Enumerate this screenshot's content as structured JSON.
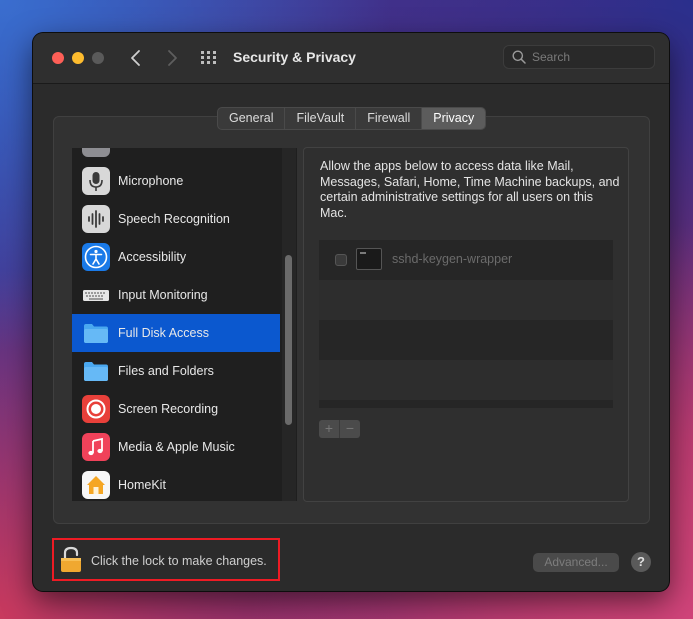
{
  "window": {
    "title": "Security & Privacy",
    "search_placeholder": "Search"
  },
  "tabs": [
    {
      "label": "General",
      "active": false
    },
    {
      "label": "FileVault",
      "active": false
    },
    {
      "label": "Firewall",
      "active": false
    },
    {
      "label": "Privacy",
      "active": true
    }
  ],
  "sidebar": {
    "items": [
      {
        "label": "Microphone",
        "icon": "microphone-icon",
        "selected": false
      },
      {
        "label": "Speech Recognition",
        "icon": "waveform-icon",
        "selected": false
      },
      {
        "label": "Accessibility",
        "icon": "accessibility-icon",
        "selected": false
      },
      {
        "label": "Input Monitoring",
        "icon": "keyboard-icon",
        "selected": false
      },
      {
        "label": "Full Disk Access",
        "icon": "folder-icon",
        "selected": true
      },
      {
        "label": "Files and Folders",
        "icon": "folder-icon",
        "selected": false
      },
      {
        "label": "Screen Recording",
        "icon": "record-icon",
        "selected": false
      },
      {
        "label": "Media & Apple Music",
        "icon": "music-note-icon",
        "selected": false
      },
      {
        "label": "HomeKit",
        "icon": "home-icon",
        "selected": false
      }
    ]
  },
  "panel": {
    "description": "Allow the apps below to access data like Mail, Messages, Safari, Home, Time Machine backups, and certain administrative settings for all users on this Mac.",
    "apps": [
      {
        "name": "sshd-keygen-wrapper",
        "checked": false
      }
    ],
    "add_label": "+",
    "remove_label": "−"
  },
  "footer": {
    "lock_text": "Click the lock to make changes.",
    "advanced_label": "Advanced...",
    "help_label": "?"
  },
  "colors": {
    "selection": "#0b58cf",
    "highlight_border": "#ee1b24"
  }
}
